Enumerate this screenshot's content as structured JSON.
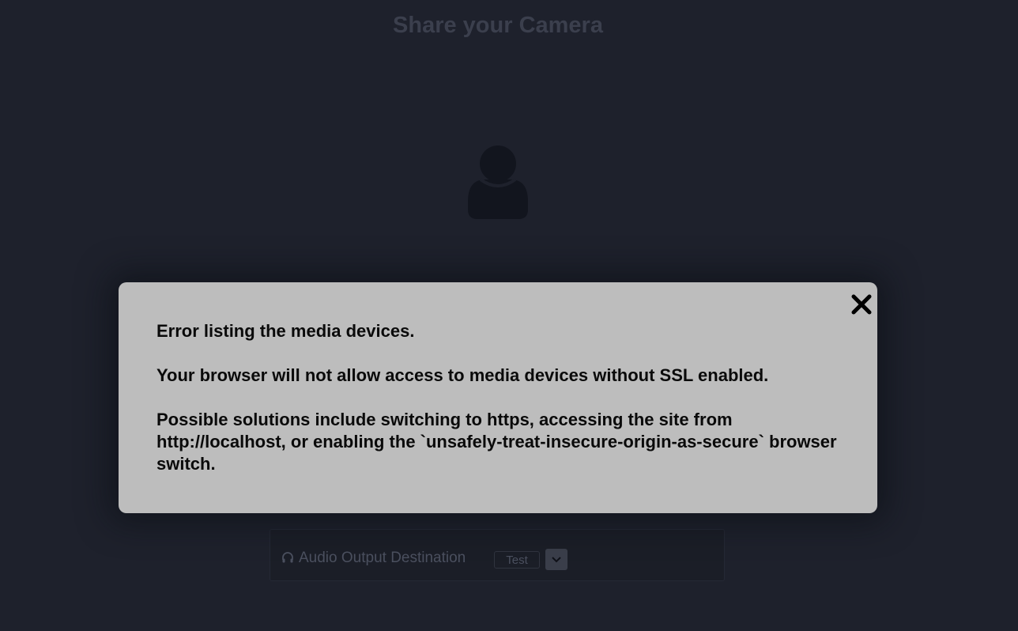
{
  "page": {
    "title": "Share your Camera"
  },
  "avatar": {
    "icon": "user-icon",
    "color": "#12151e"
  },
  "audio_output": {
    "icon": "headphones-icon",
    "label": "Audio Output Destination",
    "test_label": "Test",
    "dropdown_icon": "chevron-down-icon"
  },
  "error_modal": {
    "close_icon": "close-icon",
    "line1": "Error listing the media devices.",
    "line2": "Your browser will not allow access to media devices without SSL enabled.",
    "line3": "Possible solutions include switching to https, accessing the site from http://localhost, or enabling the `unsafely-treat-insecure-origin-as-secure` browser switch."
  },
  "colors": {
    "background": "#1e212c",
    "modal_background": "#bdbdbd",
    "modal_text": "#0a0a0a"
  }
}
